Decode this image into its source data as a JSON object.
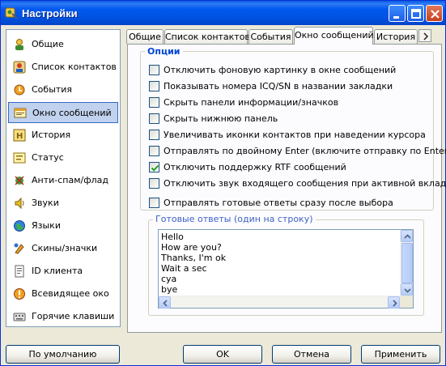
{
  "window": {
    "title": "Настройки"
  },
  "sidebar": {
    "items": [
      {
        "label": "Общие",
        "icon": "general-icon"
      },
      {
        "label": "Список контактов",
        "icon": "contacts-icon"
      },
      {
        "label": "События",
        "icon": "events-icon"
      },
      {
        "label": "Окно сообщений",
        "icon": "message-window-icon",
        "selected": true
      },
      {
        "label": "История",
        "icon": "history-icon"
      },
      {
        "label": "Статус",
        "icon": "status-icon"
      },
      {
        "label": "Анти-спам/флад",
        "icon": "antispam-icon"
      },
      {
        "label": "Звуки",
        "icon": "sound-icon"
      },
      {
        "label": "Языки",
        "icon": "language-icon"
      },
      {
        "label": "Скины/значки",
        "icon": "skins-icon"
      },
      {
        "label": "ID клиента",
        "icon": "client-id-icon"
      },
      {
        "label": "Всевидящее око",
        "icon": "all-seeing-eye-icon"
      },
      {
        "label": "Горячие клавиши",
        "icon": "hotkeys-icon"
      }
    ]
  },
  "tabs": [
    {
      "label": "Общие"
    },
    {
      "label": "Список контактов"
    },
    {
      "label": "События"
    },
    {
      "label": "Окно сообщений",
      "active": true
    },
    {
      "label": "История"
    }
  ],
  "options": {
    "group_title": "Опции",
    "checkboxes": [
      {
        "label": "Отключить фоновую картинку в окне сообщений",
        "checked": false
      },
      {
        "label": "Показывать номера ICQ/SN в названии закладки",
        "checked": false
      },
      {
        "label": "Скрыть панели информации/значков",
        "checked": false
      },
      {
        "label": "Скрыть нижнюю панель",
        "checked": false
      },
      {
        "label": "Увеличивать иконки контактов при наведении курсора",
        "checked": false
      },
      {
        "label": "Отправлять по двойному Enter (включите отправку по Enter)",
        "checked": false
      },
      {
        "label": "Отключить поддержку RTF сообщений",
        "checked": true
      },
      {
        "label": "Отключить звук входящего сообщения при активной вкладке",
        "checked": false
      },
      {
        "label": "Отправлять готовые ответы сразу после выбора",
        "checked": false
      }
    ]
  },
  "replies": {
    "group_title": "Готовые ответы (один на строку)",
    "lines": [
      "Hello",
      "How are you?",
      "Thanks, I'm ok",
      "Wait a sec",
      "cya",
      "bye"
    ]
  },
  "buttons": {
    "defaults": "По умолчанию",
    "ok": "OK",
    "cancel": "Отмена",
    "apply": "Применить"
  },
  "colors": {
    "titlebar": "#0058ee",
    "selection": "#c1d2ee",
    "group_title": "#0046d5",
    "replies_title": "#3e61c4",
    "checkmark": "#21a121"
  }
}
